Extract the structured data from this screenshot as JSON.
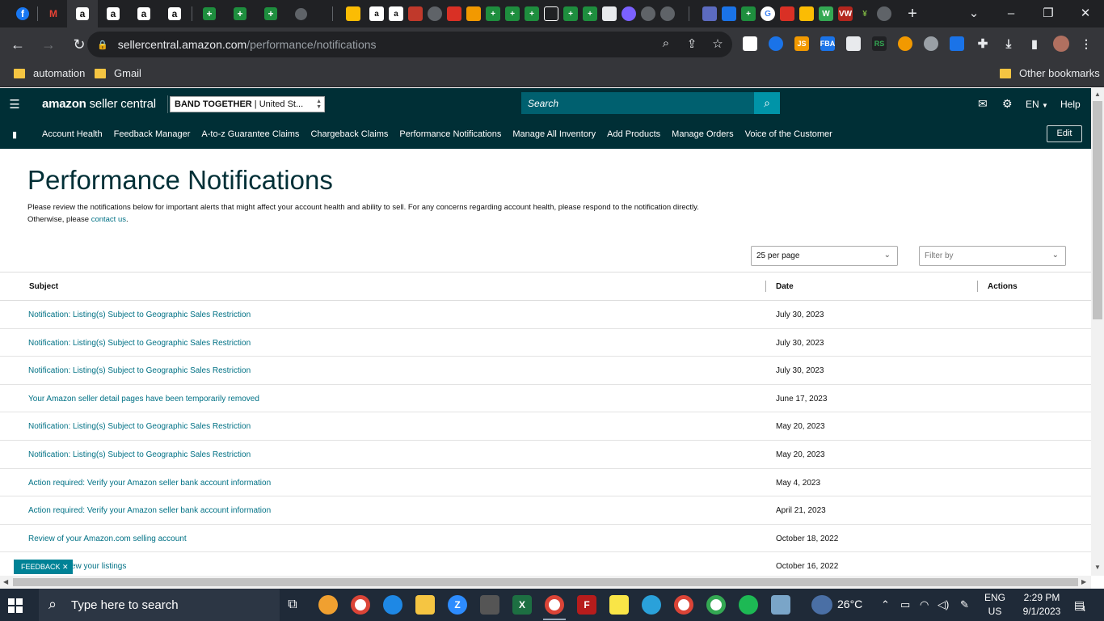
{
  "browser": {
    "url_host": "sellercentral.amazon.com",
    "url_path": "/performance/notifications",
    "tab_icons": [
      "facebook-icon",
      "gmail-icon",
      "amazon-icon",
      "amazon-icon",
      "amazon-icon",
      "amazon-icon",
      "sheets-icon",
      "sheets-icon",
      "sheets-icon",
      "globe-icon",
      "drive-icon",
      "amazon-icon",
      "amazon-icon",
      "sheets-icon",
      "sheets-icon",
      "sheets-icon",
      "sheets-icon",
      "sheets-icon",
      "sysco-icon",
      "chrome-icon"
    ],
    "new_tab_label": "+",
    "bookmarks": [
      "automation",
      "Gmail"
    ],
    "other_bookmarks": "Other bookmarks"
  },
  "header": {
    "logo_bold": "amazon",
    "logo_rest": " seller central",
    "account_bold": "BAND TOGETHER",
    "account_rest": " | United St...",
    "search_placeholder": "Search",
    "lang": "EN",
    "help": "Help"
  },
  "nav": {
    "items": [
      "Account Health",
      "Feedback Manager",
      "A-to-z Guarantee Claims",
      "Chargeback Claims",
      "Performance Notifications",
      "Manage All Inventory",
      "Add Products",
      "Manage Orders",
      "Voice of the Customer"
    ],
    "edit": "Edit"
  },
  "page": {
    "title": "Performance Notifications",
    "intro_text": "Please review the notifications below for important alerts that might affect your account health and ability to sell. For any concerns regarding account health, please respond to the notification directly. Otherwise, please ",
    "intro_link": "contact us",
    "intro_end": ".",
    "per_page": "25 per page",
    "filter_placeholder": "Filter by"
  },
  "table": {
    "headers": [
      "Subject",
      "Date",
      "Actions"
    ],
    "rows": [
      {
        "subject": "Notification: Listing(s) Subject to Geographic Sales Restriction",
        "date": "July 30, 2023"
      },
      {
        "subject": "Notification: Listing(s) Subject to Geographic Sales Restriction",
        "date": "July 30, 2023"
      },
      {
        "subject": "Notification: Listing(s) Subject to Geographic Sales Restriction",
        "date": "July 30, 2023"
      },
      {
        "subject": "Your Amazon seller detail pages have been temporarily removed",
        "date": "June 17, 2023"
      },
      {
        "subject": "Notification: Listing(s) Subject to Geographic Sales Restriction",
        "date": "May 20, 2023"
      },
      {
        "subject": "Notification: Listing(s) Subject to Geographic Sales Restriction",
        "date": "May 20, 2023"
      },
      {
        "subject": "Action required: Verify your Amazon seller bank account information",
        "date": "May 4, 2023"
      },
      {
        "subject": "Action required: Verify your Amazon seller bank account information",
        "date": "April 21, 2023"
      },
      {
        "subject": "Review of your Amazon.com selling account",
        "date": "October 18, 2022"
      },
      {
        "subject": "ew your listings",
        "date": "October 16, 2022"
      }
    ]
  },
  "feedback": "FEEDBACK",
  "taskbar": {
    "search_placeholder": "Type here to search",
    "temperature": "26°C",
    "lang_line1": "ENG",
    "lang_line2": "US",
    "time": "2:29 PM",
    "date": "9/1/2023",
    "notifications": "4"
  },
  "colors": {
    "header_bg": "#002f36",
    "search_bg": "#00606f",
    "link": "#007185",
    "feedback_bg": "#008296"
  }
}
